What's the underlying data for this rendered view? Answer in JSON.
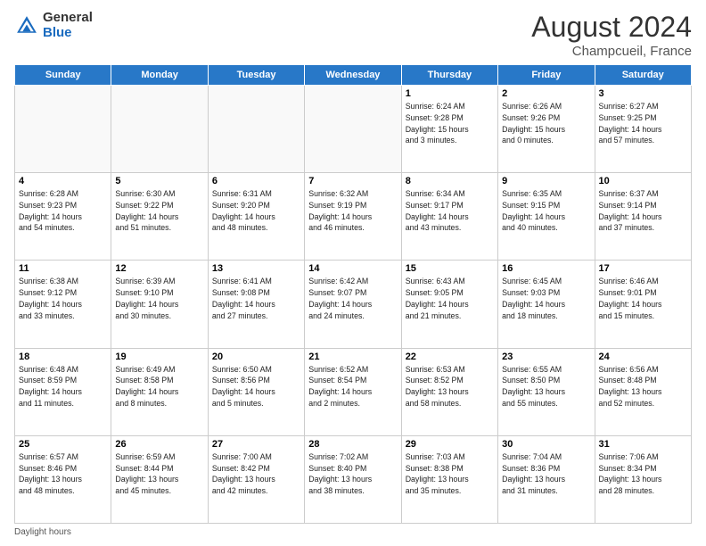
{
  "logo": {
    "general": "General",
    "blue": "Blue"
  },
  "title": "August 2024",
  "location": "Champcueil, France",
  "weekdays": [
    "Sunday",
    "Monday",
    "Tuesday",
    "Wednesday",
    "Thursday",
    "Friday",
    "Saturday"
  ],
  "weeks": [
    [
      {
        "day": "",
        "info": ""
      },
      {
        "day": "",
        "info": ""
      },
      {
        "day": "",
        "info": ""
      },
      {
        "day": "",
        "info": ""
      },
      {
        "day": "1",
        "info": "Sunrise: 6:24 AM\nSunset: 9:28 PM\nDaylight: 15 hours\nand 3 minutes."
      },
      {
        "day": "2",
        "info": "Sunrise: 6:26 AM\nSunset: 9:26 PM\nDaylight: 15 hours\nand 0 minutes."
      },
      {
        "day": "3",
        "info": "Sunrise: 6:27 AM\nSunset: 9:25 PM\nDaylight: 14 hours\nand 57 minutes."
      }
    ],
    [
      {
        "day": "4",
        "info": "Sunrise: 6:28 AM\nSunset: 9:23 PM\nDaylight: 14 hours\nand 54 minutes."
      },
      {
        "day": "5",
        "info": "Sunrise: 6:30 AM\nSunset: 9:22 PM\nDaylight: 14 hours\nand 51 minutes."
      },
      {
        "day": "6",
        "info": "Sunrise: 6:31 AM\nSunset: 9:20 PM\nDaylight: 14 hours\nand 48 minutes."
      },
      {
        "day": "7",
        "info": "Sunrise: 6:32 AM\nSunset: 9:19 PM\nDaylight: 14 hours\nand 46 minutes."
      },
      {
        "day": "8",
        "info": "Sunrise: 6:34 AM\nSunset: 9:17 PM\nDaylight: 14 hours\nand 43 minutes."
      },
      {
        "day": "9",
        "info": "Sunrise: 6:35 AM\nSunset: 9:15 PM\nDaylight: 14 hours\nand 40 minutes."
      },
      {
        "day": "10",
        "info": "Sunrise: 6:37 AM\nSunset: 9:14 PM\nDaylight: 14 hours\nand 37 minutes."
      }
    ],
    [
      {
        "day": "11",
        "info": "Sunrise: 6:38 AM\nSunset: 9:12 PM\nDaylight: 14 hours\nand 33 minutes."
      },
      {
        "day": "12",
        "info": "Sunrise: 6:39 AM\nSunset: 9:10 PM\nDaylight: 14 hours\nand 30 minutes."
      },
      {
        "day": "13",
        "info": "Sunrise: 6:41 AM\nSunset: 9:08 PM\nDaylight: 14 hours\nand 27 minutes."
      },
      {
        "day": "14",
        "info": "Sunrise: 6:42 AM\nSunset: 9:07 PM\nDaylight: 14 hours\nand 24 minutes."
      },
      {
        "day": "15",
        "info": "Sunrise: 6:43 AM\nSunset: 9:05 PM\nDaylight: 14 hours\nand 21 minutes."
      },
      {
        "day": "16",
        "info": "Sunrise: 6:45 AM\nSunset: 9:03 PM\nDaylight: 14 hours\nand 18 minutes."
      },
      {
        "day": "17",
        "info": "Sunrise: 6:46 AM\nSunset: 9:01 PM\nDaylight: 14 hours\nand 15 minutes."
      }
    ],
    [
      {
        "day": "18",
        "info": "Sunrise: 6:48 AM\nSunset: 8:59 PM\nDaylight: 14 hours\nand 11 minutes."
      },
      {
        "day": "19",
        "info": "Sunrise: 6:49 AM\nSunset: 8:58 PM\nDaylight: 14 hours\nand 8 minutes."
      },
      {
        "day": "20",
        "info": "Sunrise: 6:50 AM\nSunset: 8:56 PM\nDaylight: 14 hours\nand 5 minutes."
      },
      {
        "day": "21",
        "info": "Sunrise: 6:52 AM\nSunset: 8:54 PM\nDaylight: 14 hours\nand 2 minutes."
      },
      {
        "day": "22",
        "info": "Sunrise: 6:53 AM\nSunset: 8:52 PM\nDaylight: 13 hours\nand 58 minutes."
      },
      {
        "day": "23",
        "info": "Sunrise: 6:55 AM\nSunset: 8:50 PM\nDaylight: 13 hours\nand 55 minutes."
      },
      {
        "day": "24",
        "info": "Sunrise: 6:56 AM\nSunset: 8:48 PM\nDaylight: 13 hours\nand 52 minutes."
      }
    ],
    [
      {
        "day": "25",
        "info": "Sunrise: 6:57 AM\nSunset: 8:46 PM\nDaylight: 13 hours\nand 48 minutes."
      },
      {
        "day": "26",
        "info": "Sunrise: 6:59 AM\nSunset: 8:44 PM\nDaylight: 13 hours\nand 45 minutes."
      },
      {
        "day": "27",
        "info": "Sunrise: 7:00 AM\nSunset: 8:42 PM\nDaylight: 13 hours\nand 42 minutes."
      },
      {
        "day": "28",
        "info": "Sunrise: 7:02 AM\nSunset: 8:40 PM\nDaylight: 13 hours\nand 38 minutes."
      },
      {
        "day": "29",
        "info": "Sunrise: 7:03 AM\nSunset: 8:38 PM\nDaylight: 13 hours\nand 35 minutes."
      },
      {
        "day": "30",
        "info": "Sunrise: 7:04 AM\nSunset: 8:36 PM\nDaylight: 13 hours\nand 31 minutes."
      },
      {
        "day": "31",
        "info": "Sunrise: 7:06 AM\nSunset: 8:34 PM\nDaylight: 13 hours\nand 28 minutes."
      }
    ]
  ],
  "footer": "Daylight hours"
}
